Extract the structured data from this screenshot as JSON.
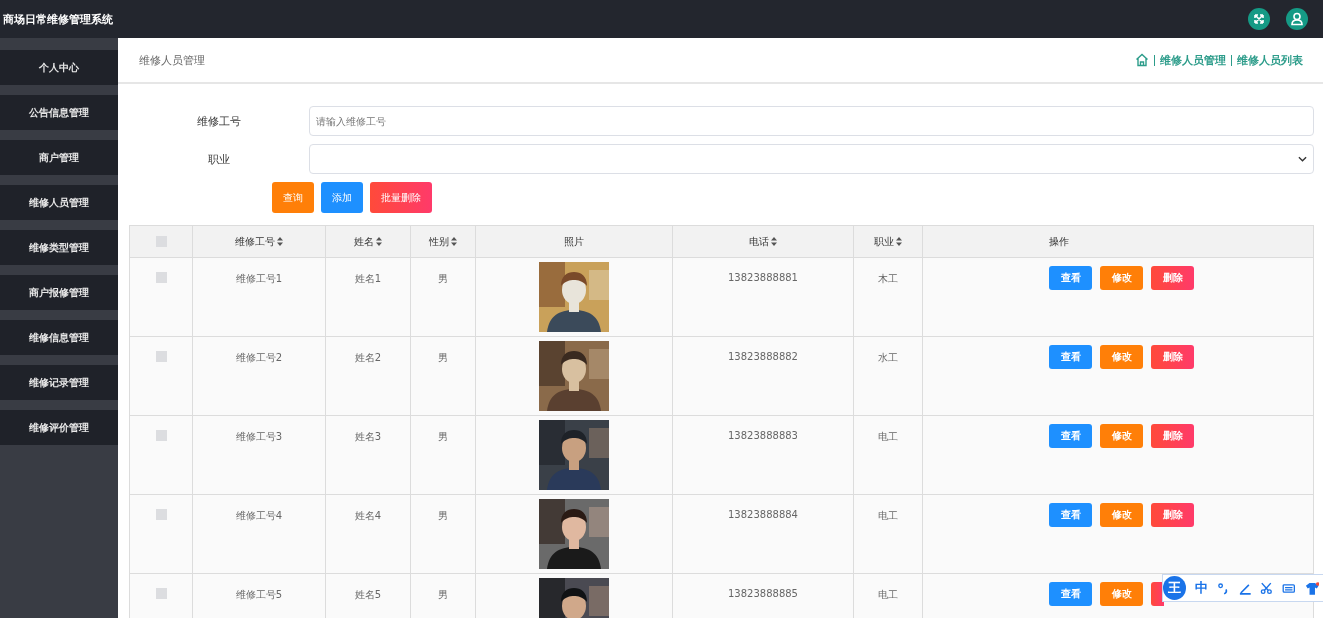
{
  "app_title": "商场日常维修管理系统",
  "sidebar": {
    "items": [
      {
        "label": "个人中心",
        "selected": false
      },
      {
        "label": "公告信息管理",
        "selected": false
      },
      {
        "label": "商户管理",
        "selected": false
      },
      {
        "label": "维修人员管理",
        "selected": false
      },
      {
        "label": "维修类型管理",
        "selected": false
      },
      {
        "label": "商户报修管理",
        "selected": false
      },
      {
        "label": "维修信息管理",
        "selected": false
      },
      {
        "label": "维修记录管理",
        "selected": false
      },
      {
        "label": "维修评价管理",
        "selected": false
      }
    ]
  },
  "page_title": "维修人员管理",
  "breadcrumb": [
    "维修人员管理",
    "维修人员列表"
  ],
  "search": {
    "fields": [
      {
        "label": "维修工号",
        "kind": "text",
        "placeholder": "请输入维修工号"
      },
      {
        "label": "职业",
        "kind": "select"
      }
    ],
    "buttons": [
      {
        "label": "查询",
        "kind": "query"
      },
      {
        "label": "添加",
        "kind": "add"
      },
      {
        "label": "批量删除",
        "kind": "batch-delete"
      }
    ]
  },
  "table": {
    "columns": [
      {
        "kind": "checkbox",
        "checked": false
      },
      {
        "kind": "text",
        "label": "维修工号",
        "sortable": true
      },
      {
        "kind": "text",
        "label": "姓名",
        "sortable": true
      },
      {
        "kind": "text",
        "label": "性别",
        "sortable": true
      },
      {
        "label": "照片",
        "sortable": false
      },
      {
        "kind": "text",
        "label": "电话",
        "sortable": true
      },
      {
        "kind": "text",
        "label": "职业",
        "sortable": true
      },
      {
        "kind": "actions",
        "label": "操作",
        "sortable": false
      }
    ],
    "rows": [
      {
        "checked": false,
        "id": "维修工号1",
        "name": "姓名1",
        "gender": "男",
        "phone": "13823888881",
        "job": "木工",
        "actions": [
          {
            "kind": "view",
            "label": "查看"
          },
          {
            "kind": "edit",
            "label": "修改"
          },
          {
            "kind": "delete",
            "label": "删除"
          }
        ]
      },
      {
        "checked": false,
        "id": "维修工号2",
        "name": "姓名2",
        "gender": "男",
        "phone": "13823888882",
        "job": "水工",
        "actions": [
          {
            "kind": "view",
            "label": "查看"
          },
          {
            "kind": "edit",
            "label": "修改"
          },
          {
            "kind": "delete",
            "label": "删除"
          }
        ]
      },
      {
        "checked": false,
        "id": "维修工号3",
        "name": "姓名3",
        "gender": "男",
        "phone": "13823888883",
        "job": "电工",
        "actions": [
          {
            "kind": "view",
            "label": "查看"
          },
          {
            "kind": "edit",
            "label": "修改"
          },
          {
            "kind": "delete",
            "label": "删除"
          }
        ]
      },
      {
        "checked": false,
        "id": "维修工号4",
        "name": "姓名4",
        "gender": "男",
        "phone": "13823888884",
        "job": "电工",
        "actions": [
          {
            "kind": "view",
            "label": "查看"
          },
          {
            "kind": "edit",
            "label": "修改"
          },
          {
            "kind": "delete",
            "label": "删除"
          }
        ]
      },
      {
        "checked": false,
        "id": "维修工号5",
        "name": "姓名5",
        "gender": "男",
        "phone": "13823888885",
        "job": "电工",
        "actions": [
          {
            "kind": "view",
            "label": "查看"
          },
          {
            "kind": "edit",
            "label": "修改"
          },
          {
            "kind": "delete"
          }
        ]
      }
    ]
  },
  "ime_toolbar": {
    "badge": "王",
    "mode": "中"
  }
}
